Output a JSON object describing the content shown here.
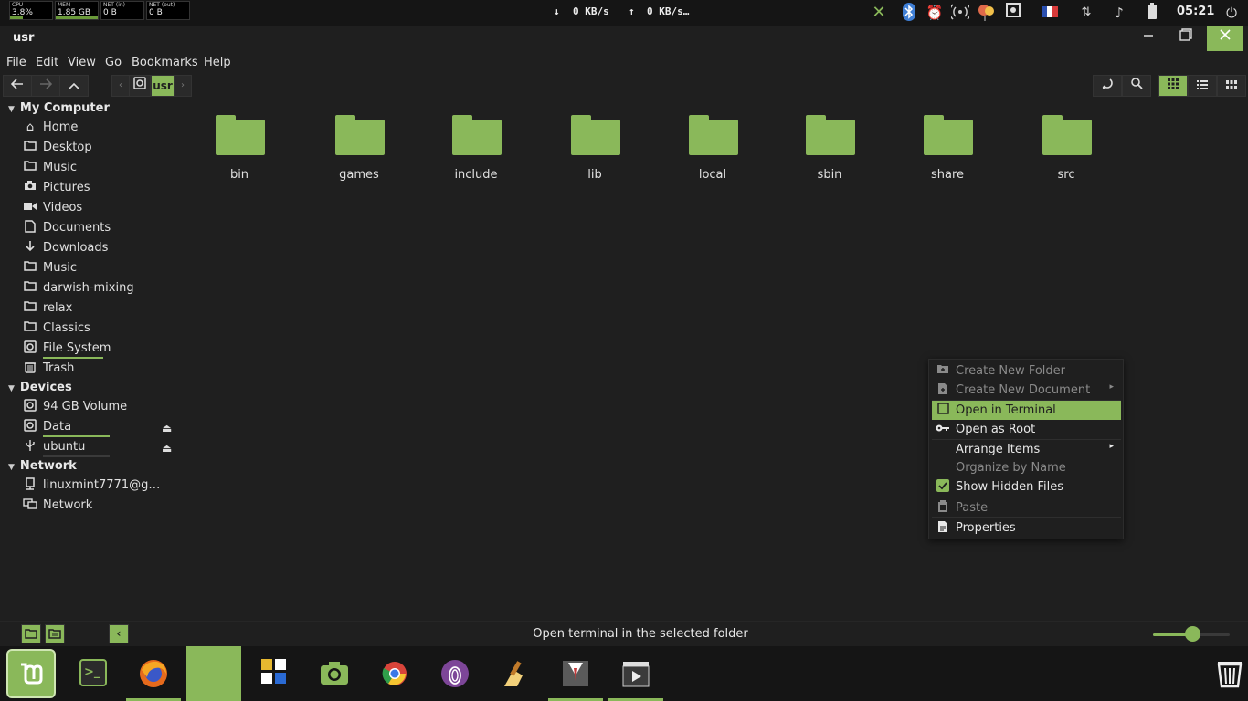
{
  "top_panel": {
    "monitors": [
      {
        "label": "CPU",
        "value": "3.8%"
      },
      {
        "label": "MEM",
        "value": "1.85 GB"
      },
      {
        "label": "NET (in)",
        "value": "0 B"
      },
      {
        "label": "NET (out)",
        "value": "0 B"
      }
    ],
    "net_down": "0 KB/s",
    "net_up": "0 KB/s…",
    "down_arrow": "↓",
    "up_arrow": "↑",
    "clock": "05:21",
    "tray_icons": [
      "close-x-icon",
      "bluetooth-icon",
      "alarm-clock-icon",
      "wireless-icon",
      "balloon-icon",
      "screenshot-icon",
      "flag-france-icon",
      "transfer-icon",
      "music-icon",
      "battery-icon"
    ]
  },
  "window": {
    "title": "usr",
    "menu": [
      "File",
      "Edit",
      "View",
      "Go",
      "Bookmarks",
      "Help"
    ],
    "path_segment": "usr"
  },
  "sidebar": {
    "sections": [
      {
        "title": "My Computer"
      },
      {
        "title": "Devices"
      },
      {
        "title": "Network"
      }
    ],
    "my_computer": [
      {
        "label": "Home",
        "icon": "home-icon"
      },
      {
        "label": "Desktop",
        "icon": "desktop-icon"
      },
      {
        "label": "Music",
        "icon": "music-icon"
      },
      {
        "label": "Pictures",
        "icon": "camera-icon"
      },
      {
        "label": "Videos",
        "icon": "video-icon"
      },
      {
        "label": "Documents",
        "icon": "document-icon"
      },
      {
        "label": "Downloads",
        "icon": "download-icon"
      },
      {
        "label": "Music",
        "icon": "folder-icon"
      },
      {
        "label": "darwish-mixing",
        "icon": "folder-icon"
      },
      {
        "label": "relax",
        "icon": "folder-icon"
      },
      {
        "label": "Classics",
        "icon": "folder-icon"
      },
      {
        "label": "File System",
        "icon": "drive-icon"
      },
      {
        "label": "Trash",
        "icon": "trash-icon"
      }
    ],
    "devices": [
      {
        "label": "94 GB Volume",
        "icon": "drive-icon"
      },
      {
        "label": "Data",
        "icon": "drive-icon"
      },
      {
        "label": "ubuntu",
        "icon": "usb-icon"
      }
    ],
    "network": [
      {
        "label": "linuxmint7771@g…",
        "icon": "computer-icon"
      },
      {
        "label": "Network",
        "icon": "network-icon"
      }
    ]
  },
  "folders": [
    "bin",
    "games",
    "include",
    "lib",
    "local",
    "sbin",
    "share",
    "src"
  ],
  "context_menu": [
    {
      "label": "Create New Folder",
      "icon": "folder-plus-icon"
    },
    {
      "label": "Create New Document",
      "icon": "document-plus-icon"
    },
    {
      "label": "Open in Terminal",
      "icon": "terminal-icon"
    },
    {
      "label": "Open as Root",
      "icon": "key-icon"
    },
    {
      "label": "Arrange Items",
      "icon": ""
    },
    {
      "label": "Organize by Name",
      "icon": ""
    },
    {
      "label": "Show Hidden Files",
      "icon": "checkbox-checked-icon"
    },
    {
      "label": "Paste",
      "icon": "clipboard-icon"
    },
    {
      "label": "Properties",
      "icon": "file-properties-icon"
    }
  ],
  "status": {
    "text": "Open terminal in the selected folder"
  },
  "taskbar": [
    {
      "name": "linux-mint-menu-icon"
    },
    {
      "name": "terminal-app-icon"
    },
    {
      "name": "firefox-icon"
    },
    {
      "name": "file-manager-icon"
    },
    {
      "name": "tile-app-icon"
    },
    {
      "name": "screenshot-camera-icon"
    },
    {
      "name": "chrome-icon"
    },
    {
      "name": "tor-browser-icon"
    },
    {
      "name": "cleaner-icon"
    },
    {
      "name": "suit-app-icon"
    },
    {
      "name": "video-editor-icon"
    },
    {
      "name": "trash-can-icon"
    }
  ],
  "colors": {
    "accent": "#8ab85a",
    "background": "#1f1f1f",
    "panel": "#151515"
  }
}
